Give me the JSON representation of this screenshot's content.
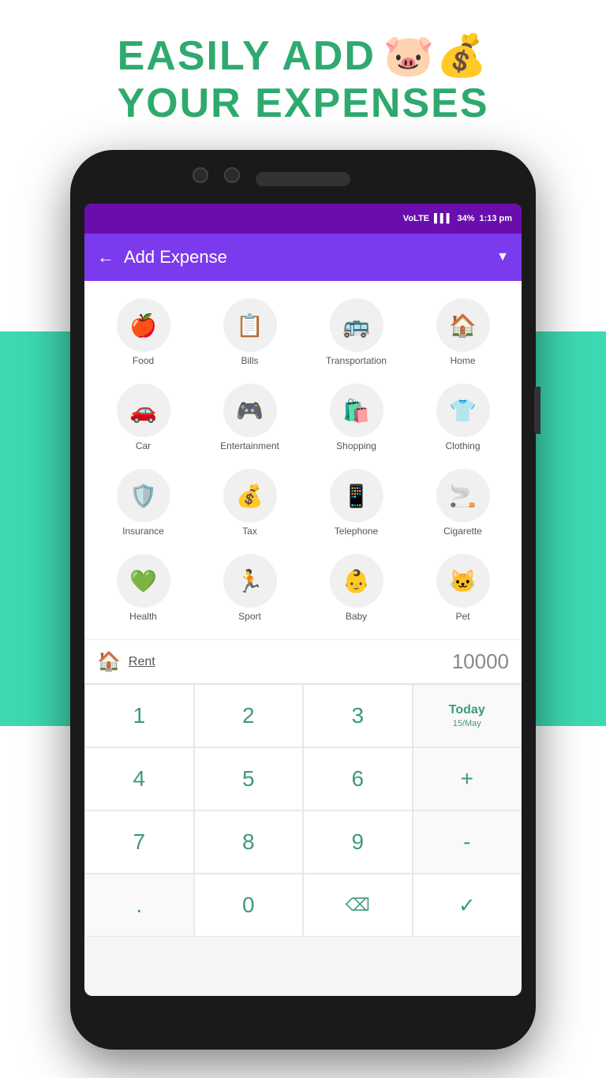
{
  "header": {
    "line1": "EASILY ADD",
    "line2": "YOUR EXPENSES",
    "piggy_emoji": "🐷"
  },
  "status_bar": {
    "network": "VoLTE",
    "signal": "📶",
    "battery": "34%",
    "time": "1:13 pm"
  },
  "app_header": {
    "back_label": "←",
    "title": "Add Expense",
    "dropdown": "▼"
  },
  "categories": [
    {
      "id": "food",
      "label": "Food",
      "emoji": "🍎"
    },
    {
      "id": "bills",
      "label": "Bills",
      "emoji": "📋"
    },
    {
      "id": "transportation",
      "label": "Transportation",
      "emoji": "🚌"
    },
    {
      "id": "home",
      "label": "Home",
      "emoji": "🏠"
    },
    {
      "id": "car",
      "label": "Car",
      "emoji": "🚗"
    },
    {
      "id": "entertainment",
      "label": "Entertainment",
      "emoji": "🎮"
    },
    {
      "id": "shopping",
      "label": "Shopping",
      "emoji": "🛍️"
    },
    {
      "id": "clothing",
      "label": "Clothing",
      "emoji": "👕"
    },
    {
      "id": "insurance",
      "label": "Insurance",
      "emoji": "🛡️"
    },
    {
      "id": "tax",
      "label": "Tax",
      "emoji": "💰"
    },
    {
      "id": "telephone",
      "label": "Telephone",
      "emoji": "📱"
    },
    {
      "id": "cigarette",
      "label": "Cigarette",
      "emoji": "🚬"
    },
    {
      "id": "health",
      "label": "Health",
      "emoji": "💚"
    },
    {
      "id": "sport",
      "label": "Sport",
      "emoji": "🏃"
    },
    {
      "id": "baby",
      "label": "Baby",
      "emoji": "👶"
    },
    {
      "id": "pet",
      "label": "Pet",
      "emoji": "🐱"
    }
  ],
  "selected": {
    "icon": "🏠",
    "label": "Rent",
    "amount": "10000"
  },
  "numpad": {
    "keys": [
      "1",
      "2",
      "3",
      "Today\n15/May",
      "4",
      "5",
      "6",
      "+",
      "7",
      "8",
      "9",
      "-",
      ".",
      "0",
      "⌫",
      "✓"
    ]
  }
}
